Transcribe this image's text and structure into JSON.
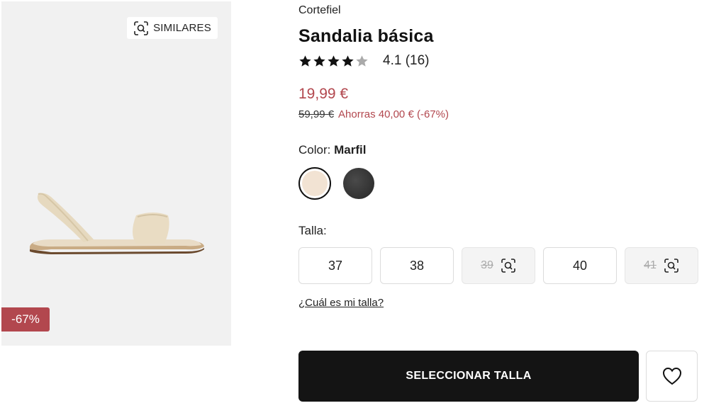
{
  "image": {
    "similar_label": "SIMILARES",
    "discount_badge": "-67%"
  },
  "product": {
    "brand": "Cortefiel",
    "title": "Sandalia básica",
    "rating_stars": 4.1,
    "rating_text": "4.1 (16)",
    "price": "19,99 €",
    "old_price": "59,99 €",
    "saving": "Ahorras 40,00 € (-67%)",
    "color_label": "Color:",
    "color_value": "Marfil",
    "swatches": [
      {
        "name": "Marfil",
        "color": "#f2e3d3",
        "selected": true
      },
      {
        "name": "dark",
        "color": "#2e2e2e",
        "selected": false
      }
    ],
    "size_label": "Talla:",
    "sizes": [
      {
        "label": "37",
        "available": true
      },
      {
        "label": "38",
        "available": true
      },
      {
        "label": "39",
        "available": false
      },
      {
        "label": "40",
        "available": true
      },
      {
        "label": "41",
        "available": false
      }
    ],
    "size_help": "¿Cuál es mi talla?",
    "cta": "SELECCIONAR TALLA"
  },
  "colors": {
    "accent": "#b2474e",
    "cta_bg": "#141414",
    "panel_bg": "#f1f1f1"
  },
  "icons": [
    "visual-search-icon",
    "star-icon",
    "heart-icon"
  ]
}
